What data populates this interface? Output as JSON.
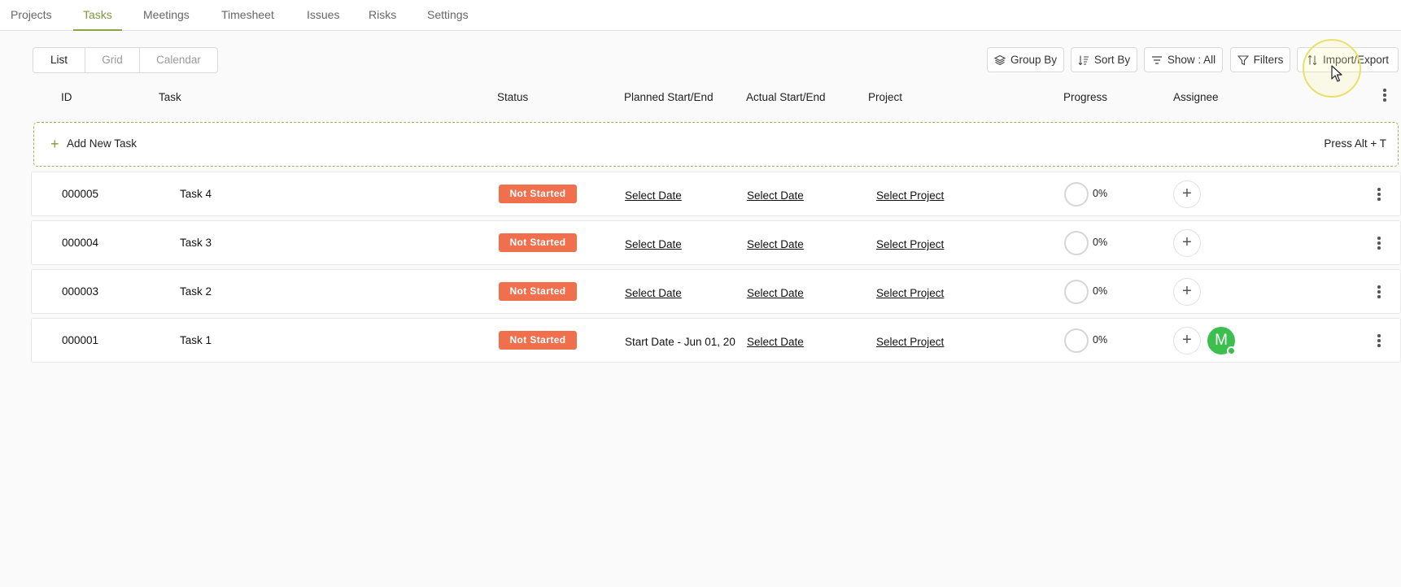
{
  "nav": {
    "tabs": [
      {
        "label": "Projects"
      },
      {
        "label": "Tasks"
      },
      {
        "label": "Meetings"
      },
      {
        "label": "Timesheet"
      },
      {
        "label": "Issues"
      },
      {
        "label": "Risks"
      },
      {
        "label": "Settings"
      }
    ],
    "active": "Tasks"
  },
  "view_switch": {
    "list": "List",
    "grid": "Grid",
    "calendar": "Calendar",
    "selected": "List"
  },
  "toolbar": {
    "group_by": "Group By",
    "sort_by": "Sort By",
    "show": "Show : All",
    "filters": "Filters",
    "import_export": "Import/Export"
  },
  "table": {
    "headers": {
      "id": "ID",
      "task": "Task",
      "status": "Status",
      "planned": "Planned Start/End",
      "actual": "Actual Start/End",
      "project": "Project",
      "progress": "Progress",
      "assignee": "Assignee"
    },
    "add_new": {
      "label": "Add New Task",
      "hint": "Press Alt + T"
    },
    "rows": [
      {
        "id": "000005",
        "task": "Task 4",
        "status": "Not Started",
        "planned": "Select Date",
        "actual": "Select Date",
        "project": "Select Project",
        "progress": "0%"
      },
      {
        "id": "000004",
        "task": "Task 3",
        "status": "Not Started",
        "planned": "Select Date",
        "actual": "Select Date",
        "project": "Select Project",
        "progress": "0%"
      },
      {
        "id": "000003",
        "task": "Task 2",
        "status": "Not Started",
        "planned": "Select Date",
        "actual": "Select Date",
        "project": "Select Project",
        "progress": "0%"
      },
      {
        "id": "000001",
        "task": "Task 1",
        "status": "Not Started",
        "planned": "Start Date - Jun 01, 20",
        "actual": "Select Date",
        "project": "Select Project",
        "progress": "0%",
        "assignee_initial": "M"
      }
    ]
  },
  "colors": {
    "accent": "#8aa544",
    "status_not_started": "#f0704e",
    "avatar": "#3cbf4f"
  }
}
